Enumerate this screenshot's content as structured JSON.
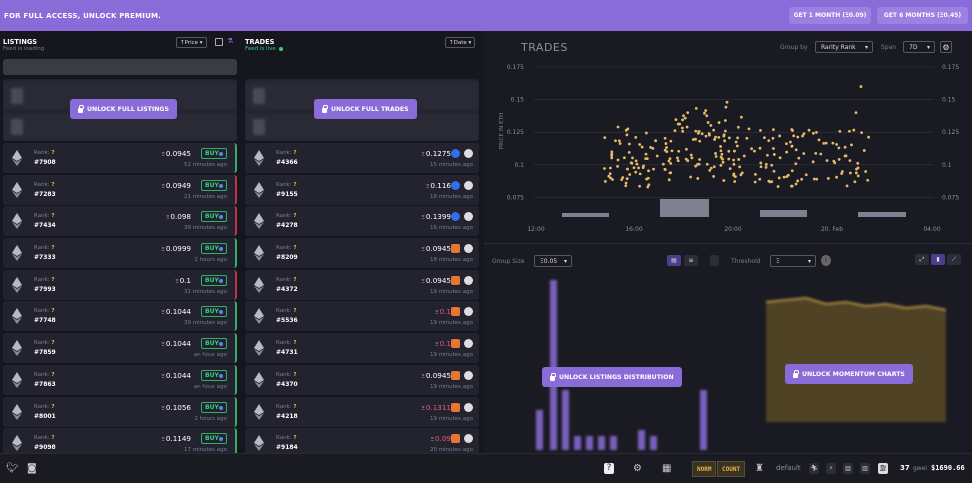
{
  "banner": {
    "text": "FOR FULL ACCESS, UNLOCK PREMIUM.",
    "btn1": "GET 1 MONTH (Ξ0.09)",
    "btn2": "GET 6 MONTHS (Ξ0.45)"
  },
  "listings": {
    "title": "LISTINGS",
    "status": "Feed is loading",
    "sort": "↑Price ▾",
    "unlock": "UNLOCK FULL LISTINGS",
    "rows": [
      {
        "rank": "?",
        "token": "#7908",
        "price": "0.0945",
        "ago": "52 minutes ago",
        "side": "grn"
      },
      {
        "rank": "?",
        "token": "#7283",
        "price": "0.0949",
        "ago": "21 minutes ago",
        "side": "red"
      },
      {
        "rank": "?",
        "token": "#7434",
        "price": "0.098",
        "ago": "39 minutes ago",
        "side": "red"
      },
      {
        "rank": "?",
        "token": "#7333",
        "price": "0.0999",
        "ago": "2 hours ago",
        "side": "grn"
      },
      {
        "rank": "?",
        "token": "#7993",
        "price": "0.1",
        "ago": "31 minutes ago",
        "side": "red"
      },
      {
        "rank": "?",
        "token": "#7748",
        "price": "0.1044",
        "ago": "39 minutes ago",
        "side": "grn"
      },
      {
        "rank": "?",
        "token": "#7859",
        "price": "0.1044",
        "ago": "an hour ago",
        "side": "grn"
      },
      {
        "rank": "?",
        "token": "#7863",
        "price": "0.1044",
        "ago": "an hour ago",
        "side": "grn"
      },
      {
        "rank": "?",
        "token": "#8001",
        "price": "0.1056",
        "ago": "2 hours ago",
        "side": "grn"
      },
      {
        "rank": "?",
        "token": "#9098",
        "price": "0.1149",
        "ago": "17 minutes ago",
        "side": "grn"
      }
    ],
    "buy_label": "BUY"
  },
  "trades": {
    "title": "TRADES",
    "status": "Feed is live",
    "sort": "↑Date ▾",
    "unlock": "UNLOCK FULL TRADES",
    "rows": [
      {
        "rank": "?",
        "token": "#4366",
        "price": "0.1275",
        "ago": "15 minutes ago",
        "m": "blue",
        "pc": "#fff"
      },
      {
        "rank": "?",
        "token": "#9155",
        "price": "0.116",
        "ago": "16 minutes ago",
        "m": "blue",
        "pc": "#fff"
      },
      {
        "rank": "?",
        "token": "#4278",
        "price": "0.1399",
        "ago": "16 minutes ago",
        "m": "blue",
        "pc": "#fff"
      },
      {
        "rank": "?",
        "token": "#8209",
        "price": "0.0945",
        "ago": "18 minutes ago",
        "m": "or",
        "pc": "#fff"
      },
      {
        "rank": "?",
        "token": "#4372",
        "price": "0.0945",
        "ago": "19 minutes ago",
        "m": "or",
        "pc": "#fff"
      },
      {
        "rank": "?",
        "token": "#5536",
        "price": "0.1",
        "ago": "19 minutes ago",
        "m": "or",
        "pc": "#e85a7a"
      },
      {
        "rank": "?",
        "token": "#4731",
        "price": "0.1",
        "ago": "19 minutes ago",
        "m": "or",
        "pc": "#e85a7a"
      },
      {
        "rank": "?",
        "token": "#4370",
        "price": "0.0945",
        "ago": "19 minutes ago",
        "m": "or",
        "pc": "#fff"
      },
      {
        "rank": "?",
        "token": "#4218",
        "price": "0.1311",
        "ago": "19 minutes ago",
        "m": "or",
        "pc": "#e85a7a"
      },
      {
        "rank": "?",
        "token": "#9184",
        "price": "0.09",
        "ago": "20 minutes ago",
        "m": "or",
        "pc": "#e85a7a"
      }
    ]
  },
  "rank_label": "Rank:",
  "tradechart": {
    "title": "TRADES",
    "group_by_label": "Group by",
    "group_by": "Rarity Rank",
    "span_label": "Span",
    "span": "7D",
    "ylabel": "PRICE IN ETH"
  },
  "chart_data": {
    "type": "scatter",
    "ylim": [
      0.06,
      0.175
    ],
    "yticks": [
      "0.175",
      "0.15",
      "0.125",
      "0.1",
      "0.075"
    ],
    "ytick_values": [
      0.175,
      0.15,
      0.125,
      0.1,
      0.075
    ],
    "xticks": [
      "12:00",
      "16:00",
      "20:00",
      "20. Feb",
      "04:00"
    ],
    "volume_bars": [
      [
        2,
        4
      ],
      [
        0,
        0
      ],
      [
        0,
        0
      ],
      [
        3,
        10
      ],
      [
        0,
        0
      ],
      [
        2,
        4
      ],
      [
        0,
        0
      ],
      [
        2,
        3
      ]
    ],
    "color": "#e8b96a"
  },
  "lower": {
    "group_size_label": "Group Size",
    "group_size": "Ξ0.05",
    "threshold_label": "Threshold",
    "threshold_value": "Ξ",
    "unlock_dist": "UNLOCK LISTINGS DISTRIBUTION",
    "unlock_mom": "UNLOCK MOMENTUM CHARTS"
  },
  "footer": {
    "btn_norm": "NORM",
    "btn_count": "COUNT",
    "default_label": "default",
    "gas": "37",
    "gas_unit": "gwei",
    "eth_price": "$1690.66"
  }
}
